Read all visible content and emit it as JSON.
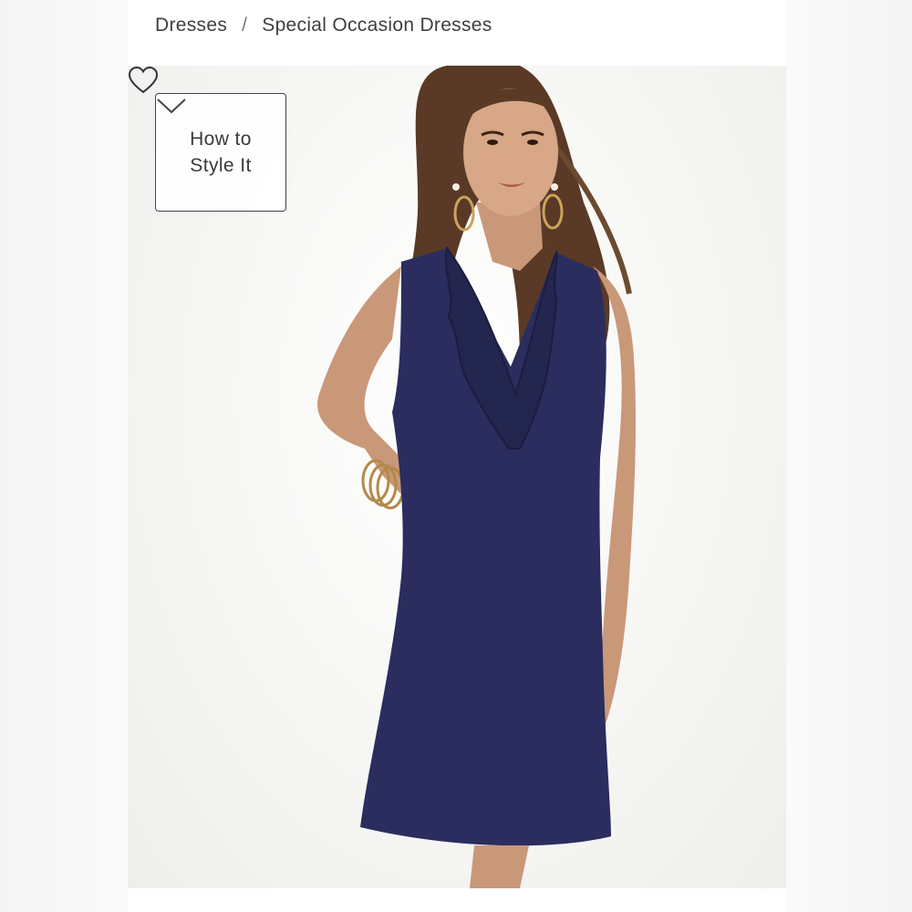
{
  "breadcrumb": {
    "items": [
      "Dresses",
      "Special Occasion Dresses"
    ],
    "separator": "/"
  },
  "style_button": {
    "line1": "How to",
    "line2": "Style It",
    "icon": "chevron-down-icon"
  },
  "wishlist": {
    "icon": "heart-outline-icon"
  },
  "product_image": {
    "description_icon": "model-photo",
    "dress_color": "#2a2d5e"
  }
}
